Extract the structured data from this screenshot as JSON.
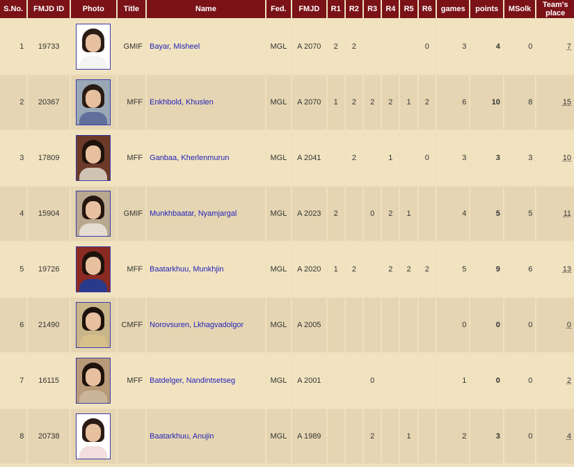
{
  "headers": [
    "S.No.",
    "FMJD ID",
    "Photo",
    "Title",
    "Name",
    "Fed.",
    "FMJD",
    "R1",
    "R2",
    "R3",
    "R4",
    "R5",
    "R6",
    "games",
    "points",
    "MSolk",
    "Team's place"
  ],
  "rows": [
    {
      "sno": "1",
      "id": "19733",
      "photo": "player-photo",
      "title": "GMIF",
      "name": "Bayar, Misheel",
      "fed": "MGL",
      "fmjd": "A 2070",
      "r1": "2",
      "r2": "2",
      "r3": "",
      "r4": "",
      "r5": "",
      "r6": "0",
      "games": "3",
      "points": "4",
      "msolk": "0",
      "place": "7",
      "photo_style": {
        "bg": "#ffffff",
        "hair": "#2a1c14",
        "body": "#f4f4f4"
      }
    },
    {
      "sno": "2",
      "id": "20367",
      "photo": "player-photo",
      "title": "MFF",
      "name": "Enkhbold, Khuslen",
      "fed": "MGL",
      "fmjd": "A 2070",
      "r1": "1",
      "r2": "2",
      "r3": "2",
      "r4": "2",
      "r5": "1",
      "r6": "2",
      "games": "6",
      "points": "10",
      "msolk": "8",
      "place": "15",
      "photo_style": {
        "bg": "#9aa8b6",
        "hair": "#2a1c14",
        "body": "#5f6e9a"
      }
    },
    {
      "sno": "3",
      "id": "17809",
      "photo": "player-photo",
      "title": "MFF",
      "name": "Ganbaa, Kherlenmurun",
      "fed": "MGL",
      "fmjd": "A 2041",
      "r1": "",
      "r2": "2",
      "r3": "",
      "r4": "1",
      "r5": "",
      "r6": "0",
      "games": "3",
      "points": "3",
      "msolk": "3",
      "place": "10",
      "photo_style": {
        "bg": "#6b3a28",
        "hair": "#1e120c",
        "body": "#cfc3b4"
      }
    },
    {
      "sno": "4",
      "id": "15904",
      "photo": "player-photo",
      "title": "GMIF",
      "name": "Munkhbaatar, Nyamjargal",
      "fed": "MGL",
      "fmjd": "A 2023",
      "r1": "2",
      "r2": "",
      "r3": "0",
      "r4": "2",
      "r5": "1",
      "r6": "",
      "games": "4",
      "points": "5",
      "msolk": "5",
      "place": "11",
      "photo_style": {
        "bg": "#b8a890",
        "hair": "#24160e",
        "body": "#e6ddd2"
      }
    },
    {
      "sno": "5",
      "id": "19726",
      "photo": "player-photo",
      "title": "MFF",
      "name": "Baatarkhuu, Munkhjin",
      "fed": "MGL",
      "fmjd": "A 2020",
      "r1": "1",
      "r2": "2",
      "r3": "",
      "r4": "2",
      "r5": "2",
      "r6": "2",
      "games": "5",
      "points": "9",
      "msolk": "6",
      "place": "13",
      "photo_style": {
        "bg": "#8a2a22",
        "hair": "#1e120c",
        "body": "#2a3a8a"
      }
    },
    {
      "sno": "6",
      "id": "21490",
      "photo": "player-photo",
      "title": "CMFF",
      "name": "Norovsuren, Lkhagvadolgor",
      "fed": "MGL",
      "fmjd": "A 2005",
      "r1": "",
      "r2": "",
      "r3": "",
      "r4": "",
      "r5": "",
      "r6": "",
      "games": "0",
      "points": "0",
      "msolk": "0",
      "place": "0",
      "photo_style": {
        "bg": "#c9b58a",
        "hair": "#1e120c",
        "body": "#d8c08a"
      }
    },
    {
      "sno": "7",
      "id": "16115",
      "photo": "player-photo",
      "title": "MFF",
      "name": "Batdelger, Nandintsetseg",
      "fed": "MGL",
      "fmjd": "A 2001",
      "r1": "",
      "r2": "",
      "r3": "0",
      "r4": "",
      "r5": "",
      "r6": "",
      "games": "1",
      "points": "0",
      "msolk": "0",
      "place": "2",
      "photo_style": {
        "bg": "#b89a78",
        "hair": "#1e120c",
        "body": "#cbb59a"
      }
    },
    {
      "sno": "8",
      "id": "20738",
      "photo": "player-photo",
      "title": "",
      "name": "Baatarkhuu, Anujin",
      "fed": "MGL",
      "fmjd": "A 1989",
      "r1": "",
      "r2": "",
      "r3": "2",
      "r4": "",
      "r5": "1",
      "r6": "",
      "games": "2",
      "points": "3",
      "msolk": "0",
      "place": "4",
      "photo_style": {
        "bg": "#ffffff",
        "hair": "#2a1c14",
        "body": "#f2dede"
      }
    }
  ],
  "colors": {
    "header_bg": "#7a1218",
    "row_odd": "#f1e3bf",
    "row_even": "#e5d5b2",
    "link": "#2323b8"
  }
}
